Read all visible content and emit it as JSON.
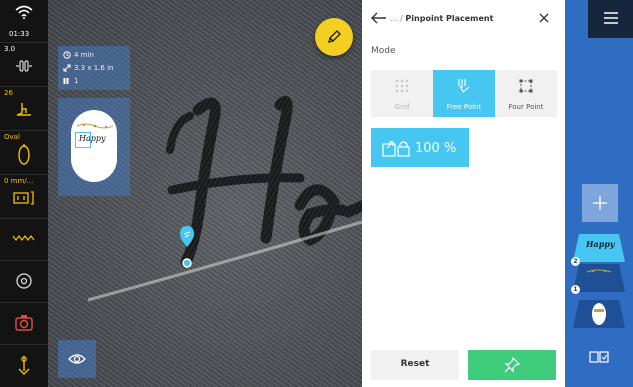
{
  "status_rail": {
    "time": "01:33",
    "stitch_length": "3.0",
    "thread_value": "26",
    "hoop_name": "Oval",
    "feed_value": "0 mm/..."
  },
  "info_box": {
    "time": "4 min",
    "size": "3.3 x 1.6 in",
    "count": "1"
  },
  "preview_text": "Happy",
  "panel": {
    "back_icon": "arrow-left-icon",
    "breadcrumb_prefix": "... /",
    "breadcrumb_title": "Pinpoint Placement",
    "close_icon": "close-icon",
    "mode_label": "Mode",
    "modes": [
      {
        "label": "Grid",
        "state": "disabled"
      },
      {
        "label": "Free Point",
        "state": "active"
      },
      {
        "label": "Four Point",
        "state": "normal"
      }
    ],
    "scale_value": "100 %",
    "reset_label": "Reset"
  },
  "layers": {
    "badges": [
      "2",
      "1"
    ],
    "top_layer_text": "Happy"
  },
  "colors": {
    "accent_blue": "#46c7f1",
    "confirm_green": "#3fcc7c",
    "edit_yellow": "#f3cf21",
    "sidebar_blue": "#2f6dc2",
    "status_yellow": "#f0c000"
  }
}
